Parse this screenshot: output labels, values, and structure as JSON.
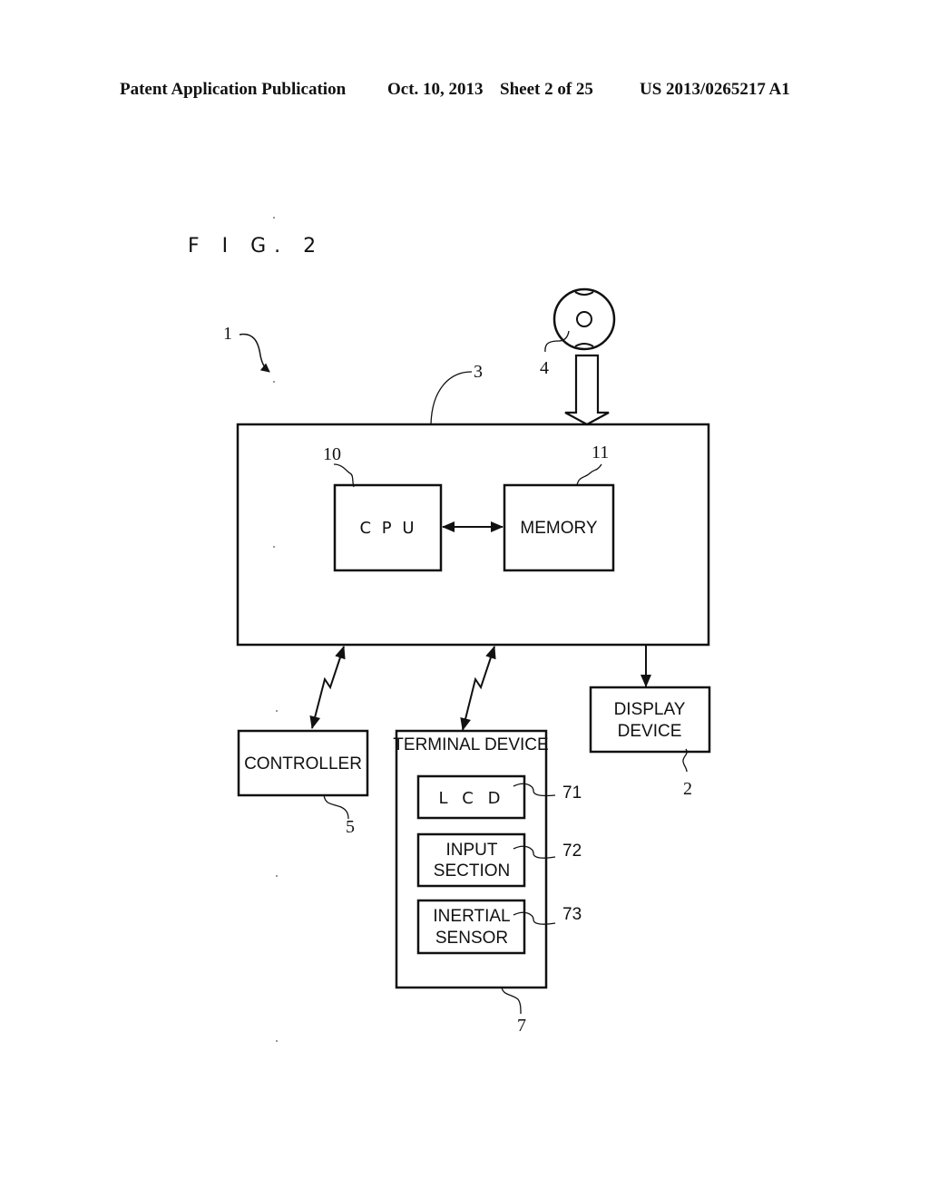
{
  "header": {
    "publication": "Patent Application Publication",
    "date": "Oct. 10, 2013",
    "sheet": "Sheet 2 of 25",
    "number": "US 2013/0265217 A1"
  },
  "figure": {
    "title": "F I G. 2",
    "system_ref": "1",
    "main_unit": {
      "ref": "3",
      "cpu": {
        "ref": "10",
        "label": "C P U"
      },
      "memory": {
        "ref": "11",
        "label": "MEMORY"
      }
    },
    "disc": {
      "ref": "4"
    },
    "controller": {
      "ref": "5",
      "label": "CONTROLLER"
    },
    "display_device": {
      "ref": "2",
      "line1": "DISPLAY",
      "line2": "DEVICE"
    },
    "terminal_device": {
      "ref": "7",
      "label": "TERMINAL DEVICE",
      "lcd": {
        "ref": "71",
        "label": "L C D"
      },
      "input_section": {
        "ref": "72",
        "line1": "INPUT",
        "line2": "SECTION"
      },
      "inertial_sensor": {
        "ref": "73",
        "line1": "INERTIAL",
        "line2": "SENSOR"
      }
    }
  }
}
